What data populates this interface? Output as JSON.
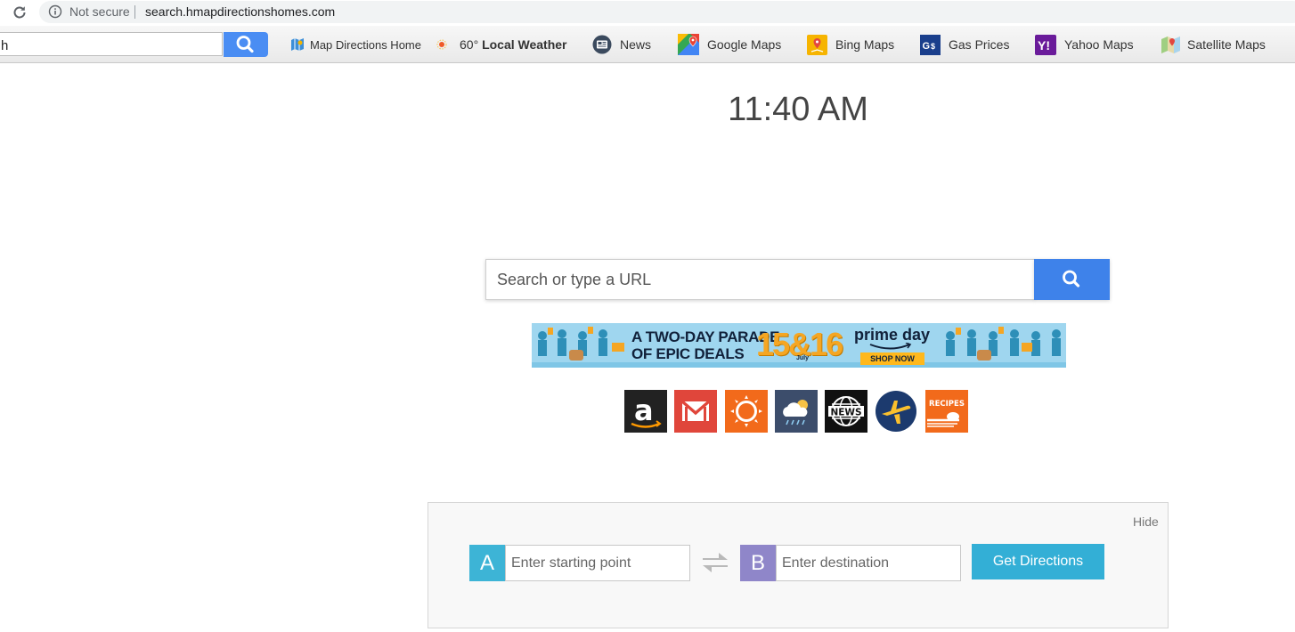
{
  "browser": {
    "security_label": "Not secure",
    "url": "search.hmapdirectionshomes.com"
  },
  "toolbar": {
    "search_value": "h",
    "items": [
      {
        "label": "Map Directions Home",
        "icon": "map-directions-icon"
      },
      {
        "temp": "60°",
        "label": "Local Weather",
        "icon": "weather-dot-icon"
      },
      {
        "label": "News",
        "icon": "news-icon"
      },
      {
        "label": "Google Maps",
        "icon": "google-maps-icon"
      },
      {
        "label": "Bing Maps",
        "icon": "bing-maps-icon"
      },
      {
        "label": "Gas Prices",
        "icon": "gas-prices-icon"
      },
      {
        "label": "Yahoo Maps",
        "icon": "yahoo-maps-icon"
      },
      {
        "label": "Satellite Maps",
        "icon": "satellite-maps-icon"
      }
    ]
  },
  "clock": "11:40 AM",
  "search": {
    "placeholder": "Search or type a URL"
  },
  "banner": {
    "headline_1": "A TWO-DAY PARADE",
    "headline_2": "OF EPIC DEALS",
    "dates": "15&16",
    "month": "July",
    "brand": "prime day",
    "cta": "SHOP NOW"
  },
  "quick_links": [
    {
      "name": "amazon",
      "icon": "amazon-icon",
      "color": "#222222"
    },
    {
      "name": "gmail",
      "icon": "mail-icon",
      "color": "#e0463b"
    },
    {
      "name": "weather",
      "icon": "sun-icon",
      "color": "#f26a1b"
    },
    {
      "name": "forecast",
      "icon": "cloud-rain-icon",
      "color": "#3c4d6b"
    },
    {
      "name": "news",
      "icon": "news-globe-icon",
      "color": "#111111"
    },
    {
      "name": "expedia",
      "icon": "plane-icon",
      "color": "#1c3a6e"
    },
    {
      "name": "recipes",
      "icon": "recipes-icon",
      "color": "#f26a1b",
      "label": "RECIPES"
    }
  ],
  "directions": {
    "hide_label": "Hide",
    "start_marker": "A",
    "start_placeholder": "Enter starting point",
    "end_marker": "B",
    "end_placeholder": "Enter destination",
    "button_label": "Get Directions",
    "colors": {
      "a": "#3db4d6",
      "b": "#8f86c9",
      "button": "#33afd6"
    }
  }
}
